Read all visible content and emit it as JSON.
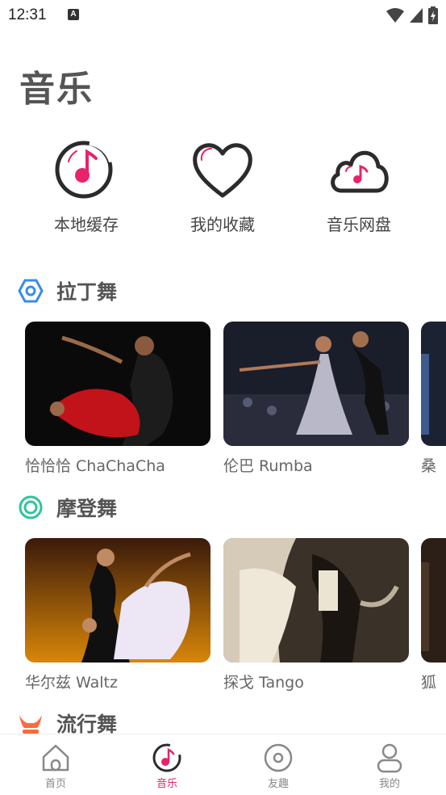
{
  "status": {
    "time": "12:31",
    "a_badge": "A"
  },
  "page": {
    "title": "音乐"
  },
  "quick_actions": [
    {
      "label": "本地缓存",
      "icon": "music-disc-icon"
    },
    {
      "label": "我的收藏",
      "icon": "heart-icon"
    },
    {
      "label": "音乐网盘",
      "icon": "cloud-music-icon"
    }
  ],
  "sections": [
    {
      "title": "拉丁舞",
      "icon": "hexagon-icon",
      "icon_color": "#3b8be6",
      "cards": [
        {
          "caption": "恰恰恰 ChaChaCha"
        },
        {
          "caption": "伦巴 Rumba"
        },
        {
          "caption": "桑"
        }
      ]
    },
    {
      "title": "摩登舞",
      "icon": "ring-icon",
      "icon_color": "#2ec49a",
      "cards": [
        {
          "caption": "华尔兹 Waltz"
        },
        {
          "caption": "探戈 Tango"
        },
        {
          "caption": "狐"
        }
      ]
    },
    {
      "title": "流行舞",
      "icon": "horns-icon",
      "icon_color": "#ff6a3d"
    }
  ],
  "bottom_nav": [
    {
      "label": "首页",
      "icon": "home-icon",
      "active": false
    },
    {
      "label": "音乐",
      "icon": "music-note-icon",
      "active": true
    },
    {
      "label": "友趣",
      "icon": "disc-icon",
      "active": false
    },
    {
      "label": "我的",
      "icon": "user-icon",
      "active": false
    }
  ],
  "colors": {
    "accent": "#e6236b",
    "text_dark": "#555555",
    "nav_inactive": "#888888"
  }
}
